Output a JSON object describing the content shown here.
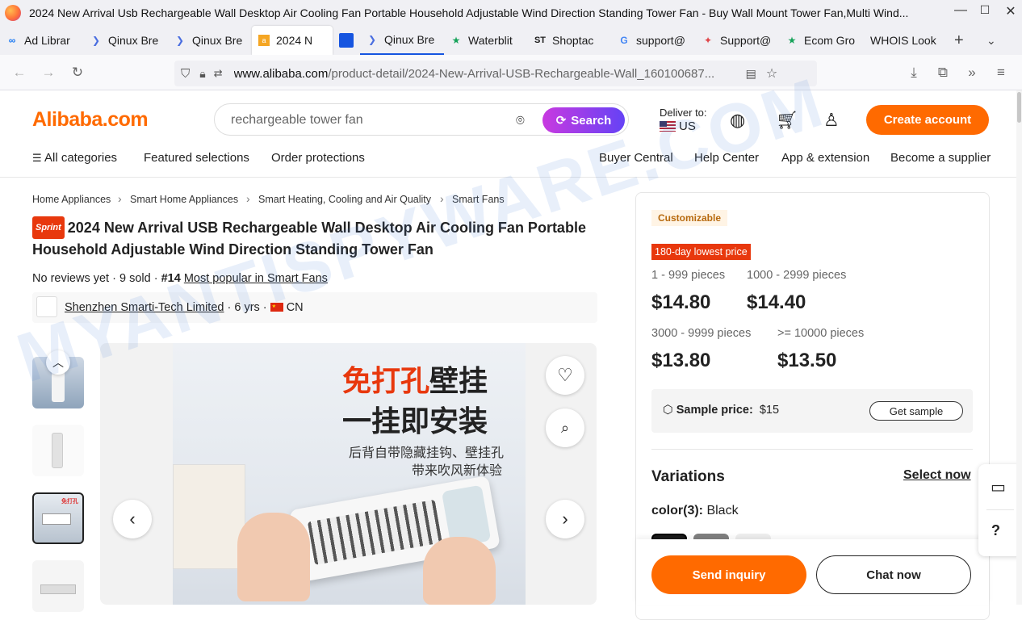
{
  "window": {
    "title": "2024 New Arrival Usb Rechargeable Wall Desktop Air Cooling Fan Portable Household Adjustable Wind Direction Standing Tower Fan - Buy Wall Mount Tower Fan,Multi Wind...",
    "minimize": "—",
    "maximize": "☐",
    "close": "✕"
  },
  "tabs": [
    {
      "label": "Ad Librar",
      "icon": "meta-icon"
    },
    {
      "label": "Qinux Bre",
      "icon": "page-icon"
    },
    {
      "label": "Qinux Bre",
      "icon": "page-icon"
    },
    {
      "label": "2024 N",
      "icon": "alibaba-icon",
      "active": true
    },
    {
      "label": "",
      "icon": "blue-square-icon"
    },
    {
      "label": "Qinux Bre",
      "icon": "page-icon"
    },
    {
      "label": "Waterblit",
      "icon": "star-icon"
    },
    {
      "label": "Shoptac",
      "icon": "shoptac-icon"
    },
    {
      "label": "support@",
      "icon": "google-icon"
    },
    {
      "label": "Support@",
      "icon": "support-icon"
    },
    {
      "label": "Ecom Gro",
      "icon": "star-icon"
    },
    {
      "label": "WHOIS Look",
      "icon": ""
    }
  ],
  "url": {
    "domain": "www.alibaba.com",
    "path": "/product-detail/2024-New-Arrival-USB-Rechargeable-Wall_160100687..."
  },
  "header": {
    "logo": "Alibaba.com",
    "search_value": "rechargeable tower fan",
    "search_button": "Search",
    "deliver_to_label": "Deliver to:",
    "deliver_to_country": "US",
    "create_account": "Create account"
  },
  "menu": {
    "all_categories": "All categories",
    "featured": "Featured selections",
    "protections": "Order protections",
    "buyer_central": "Buyer Central",
    "help_center": "Help Center",
    "app_extension": "App & extension",
    "become_supplier": "Become a supplier"
  },
  "breadcrumb": [
    "Home Appliances",
    "Smart Home Appliances",
    "Smart Heating, Cooling and Air Quality",
    "Smart Fans"
  ],
  "product": {
    "badge": "Sprint",
    "title": "2024 New Arrival USB Rechargeable Wall Desktop Air Cooling Fan Portable Household Adjustable Wind Direction Standing Tower Fan",
    "reviews": "No reviews yet",
    "sold": "9 sold",
    "rank": "#14",
    "rank_link": "Most popular in Smart Fans",
    "supplier_name": "Shenzhen Smarti-Tech Limited",
    "supplier_years": "6 yrs",
    "supplier_country": "CN",
    "image_text_1_red": "免打孔",
    "image_text_1_black": "壁挂",
    "image_text_2": "一挂即安装",
    "image_text_3": "后背自带隐藏挂钩、壁挂孔",
    "image_text_4": "带来吹风新体验"
  },
  "pricing": {
    "customizable": "Customizable",
    "lowest_tag": "180-day lowest price",
    "tiers": [
      {
        "range": "1 - 999 pieces",
        "price": "$14.80"
      },
      {
        "range": "1000 - 2999 pieces",
        "price": "$14.40"
      },
      {
        "range": "3000 - 9999 pieces",
        "price": "$13.80"
      },
      {
        "range": ">= 10000 pieces",
        "price": "$13.50"
      }
    ],
    "sample_label": "Sample price:",
    "sample_value": "$15",
    "get_sample": "Get sample"
  },
  "variations": {
    "heading": "Variations",
    "select_now": "Select now",
    "color_label": "color(3):",
    "color_value": "Black",
    "swatch_colors": [
      "#1a1a1a",
      "#808080",
      "#eeeeee"
    ]
  },
  "actions": {
    "send_inquiry": "Send inquiry",
    "chat_now": "Chat now"
  },
  "watermark": "MYANTISPYWARE.COM"
}
